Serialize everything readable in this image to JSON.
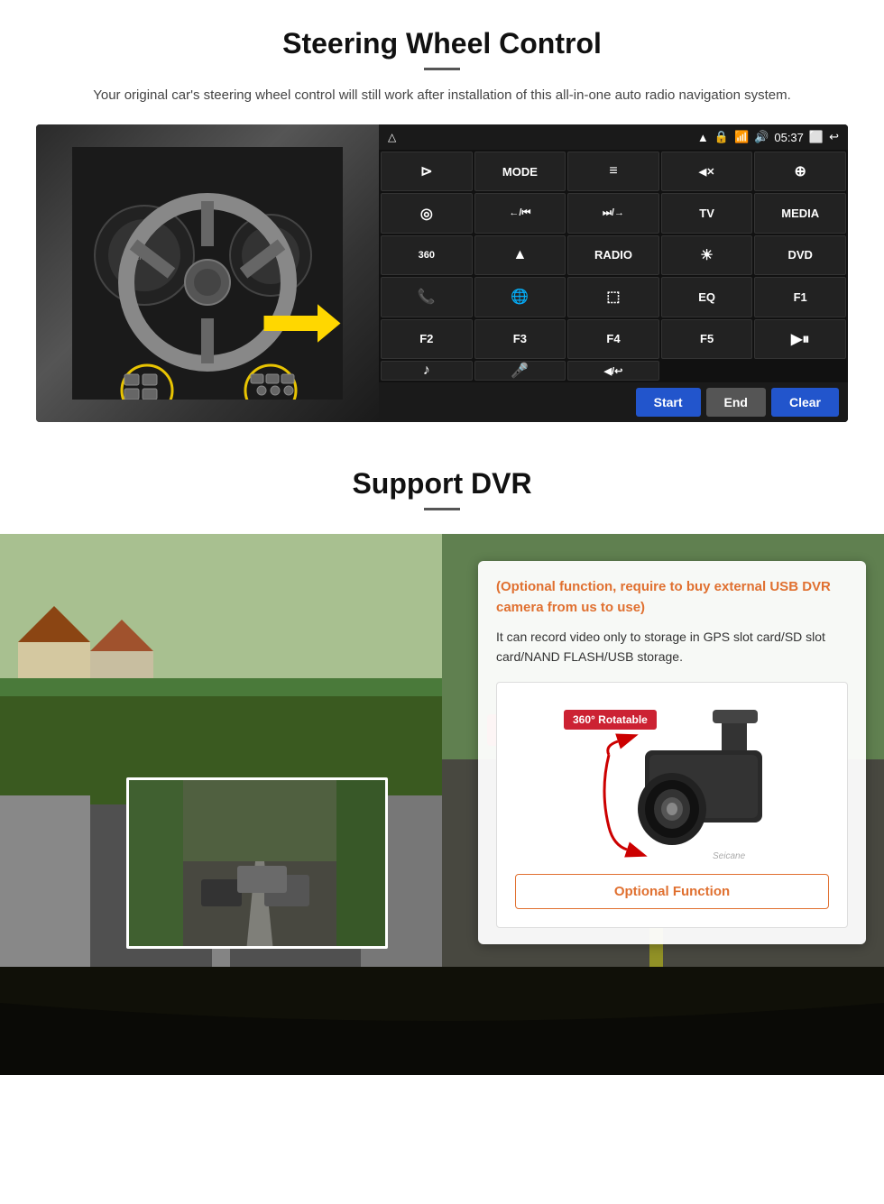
{
  "steering": {
    "title": "Steering Wheel Control",
    "subtitle": "Your original car's steering wheel control will still work after installation of this all-in-one auto radio navigation system.",
    "status_bar": {
      "wifi_icon": "📶",
      "lock_icon": "🔒",
      "sim_icon": "📱",
      "sound_icon": "🔊",
      "time": "05:37",
      "window_icon": "🗔",
      "back_icon": "↩"
    },
    "buttons": [
      {
        "label": "⊳",
        "id": "nav"
      },
      {
        "label": "MODE",
        "id": "mode"
      },
      {
        "label": "≡",
        "id": "menu"
      },
      {
        "label": "◀✕",
        "id": "mute"
      },
      {
        "label": "⊕",
        "id": "apps"
      },
      {
        "label": "◎",
        "id": "settings"
      },
      {
        "label": "←/⏮",
        "id": "prev"
      },
      {
        "label": "⏭/→",
        "id": "next"
      },
      {
        "label": "TV",
        "id": "tv"
      },
      {
        "label": "MEDIA",
        "id": "media"
      },
      {
        "label": "360",
        "id": "360"
      },
      {
        "label": "▲",
        "id": "eject"
      },
      {
        "label": "RADIO",
        "id": "radio"
      },
      {
        "label": "☀",
        "id": "brightness"
      },
      {
        "label": "DVD",
        "id": "dvd"
      },
      {
        "label": "📞",
        "id": "phone"
      },
      {
        "label": "🌐",
        "id": "web"
      },
      {
        "label": "⬚",
        "id": "mirror"
      },
      {
        "label": "EQ",
        "id": "eq"
      },
      {
        "label": "F1",
        "id": "f1"
      },
      {
        "label": "F2",
        "id": "f2"
      },
      {
        "label": "F3",
        "id": "f3"
      },
      {
        "label": "F4",
        "id": "f4"
      },
      {
        "label": "F5",
        "id": "f5"
      },
      {
        "label": "▶⏸",
        "id": "playpause"
      },
      {
        "label": "♪",
        "id": "music"
      },
      {
        "label": "🎤",
        "id": "mic"
      },
      {
        "label": "◀/↩",
        "id": "back2"
      }
    ],
    "controls": {
      "start": "Start",
      "end": "End",
      "clear": "Clear"
    }
  },
  "dvr": {
    "title": "Support DVR",
    "optional_text": "(Optional function, require to buy external USB DVR camera from us to use)",
    "desc_text": "It can record video only to storage in GPS slot card/SD slot card/NAND FLASH/USB storage.",
    "rotatable_badge": "360° Rotatable",
    "watermark": "Seicane",
    "optional_function_label": "Optional Function"
  }
}
